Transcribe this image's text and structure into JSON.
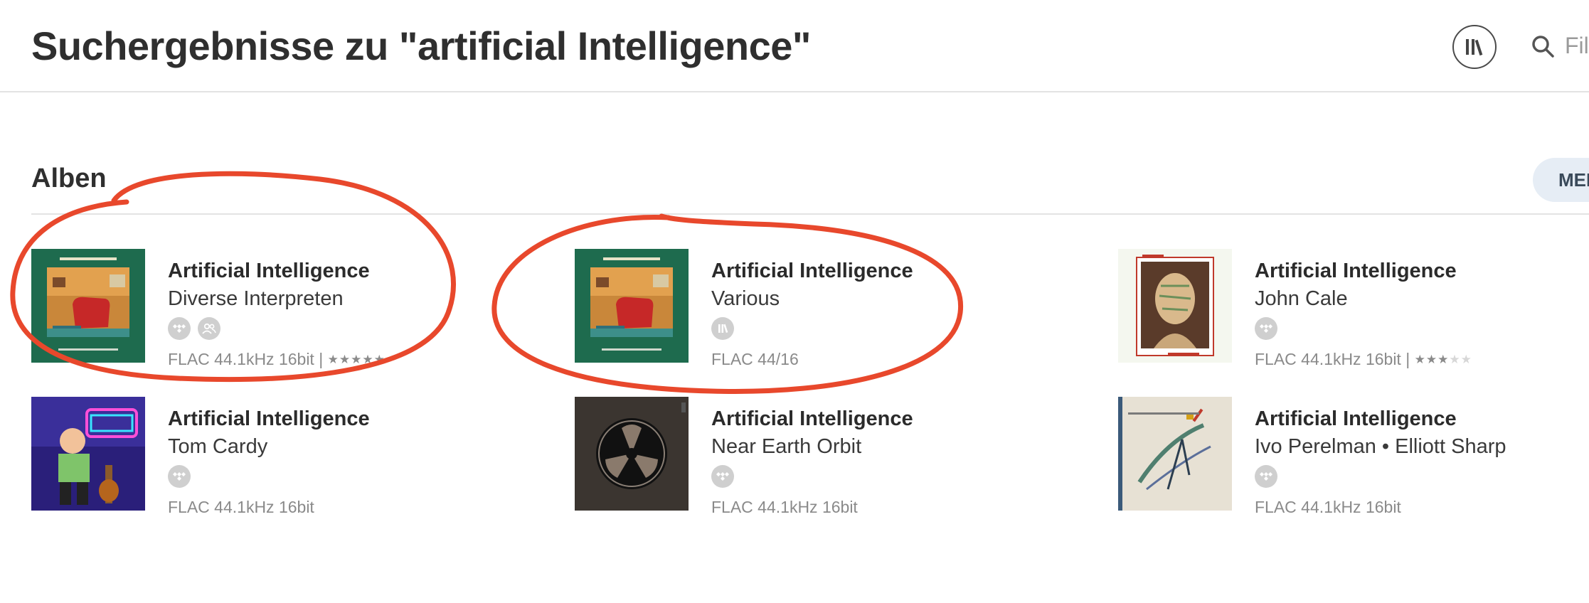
{
  "header": {
    "title": "Suchergebnisse zu \"artificial Intelligence\"",
    "search_placeholder": "Fil"
  },
  "section": {
    "title": "Alben",
    "more_label": "MEHR"
  },
  "albums": [
    {
      "title": "Artificial Intelligence",
      "artist": "Diverse Interpreten",
      "format": "FLAC 44.1kHz 16bit",
      "separator": " | ",
      "badges": [
        "tidal-icon",
        "users-icon"
      ],
      "rating": 5,
      "cover": "green-room-cover",
      "highlighted": true
    },
    {
      "title": "Artificial Intelligence",
      "artist": "Various",
      "format": "FLAC 44/16",
      "separator": "",
      "badges": [
        "library-icon"
      ],
      "rating": null,
      "cover": "green-room-cover",
      "highlighted": true
    },
    {
      "title": "Artificial Intelligence",
      "artist": "John Cale",
      "format": "FLAC 44.1kHz 16bit",
      "separator": " | ",
      "badges": [
        "tidal-icon"
      ],
      "rating": 2.5,
      "cover": "portrait-cover",
      "highlighted": false
    },
    {
      "title": "Artificial Intelligence",
      "artist": "Tom Cardy",
      "format": "FLAC 44.1kHz 16bit",
      "separator": "",
      "badges": [
        "tidal-icon"
      ],
      "rating": null,
      "cover": "neon-character-cover",
      "highlighted": false
    },
    {
      "title": "Artificial Intelligence",
      "artist": "Near Earth Orbit",
      "format": "FLAC 44.1kHz 16bit",
      "separator": "",
      "badges": [
        "tidal-icon"
      ],
      "rating": null,
      "cover": "fan-symbol-cover",
      "highlighted": false
    },
    {
      "title": "Artificial Intelligence",
      "artist": "Ivo Perelman • Elliott Sharp",
      "format": "FLAC 44.1kHz 16bit",
      "separator": "",
      "badges": [
        "tidal-icon"
      ],
      "rating": null,
      "cover": "abstract-strokes-cover",
      "highlighted": false
    }
  ],
  "colors": {
    "annotation": "#e8482c",
    "cover_green": "#1e6b4e",
    "more_button_bg": "#e6edf5",
    "badge_gray": "#cfcfcf"
  }
}
